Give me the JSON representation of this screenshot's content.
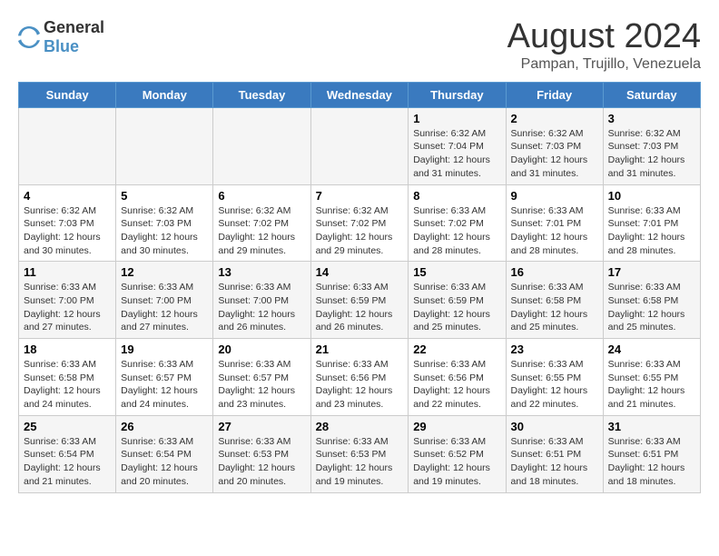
{
  "header": {
    "logo_general": "General",
    "logo_blue": "Blue",
    "title": "August 2024",
    "subtitle": "Pampan, Trujillo, Venezuela"
  },
  "days_of_week": [
    "Sunday",
    "Monday",
    "Tuesday",
    "Wednesday",
    "Thursday",
    "Friday",
    "Saturday"
  ],
  "weeks": [
    [
      {
        "day": "",
        "info": ""
      },
      {
        "day": "",
        "info": ""
      },
      {
        "day": "",
        "info": ""
      },
      {
        "day": "",
        "info": ""
      },
      {
        "day": "1",
        "info": "Sunrise: 6:32 AM\nSunset: 7:04 PM\nDaylight: 12 hours\nand 31 minutes."
      },
      {
        "day": "2",
        "info": "Sunrise: 6:32 AM\nSunset: 7:03 PM\nDaylight: 12 hours\nand 31 minutes."
      },
      {
        "day": "3",
        "info": "Sunrise: 6:32 AM\nSunset: 7:03 PM\nDaylight: 12 hours\nand 31 minutes."
      }
    ],
    [
      {
        "day": "4",
        "info": "Sunrise: 6:32 AM\nSunset: 7:03 PM\nDaylight: 12 hours\nand 30 minutes."
      },
      {
        "day": "5",
        "info": "Sunrise: 6:32 AM\nSunset: 7:03 PM\nDaylight: 12 hours\nand 30 minutes."
      },
      {
        "day": "6",
        "info": "Sunrise: 6:32 AM\nSunset: 7:02 PM\nDaylight: 12 hours\nand 29 minutes."
      },
      {
        "day": "7",
        "info": "Sunrise: 6:32 AM\nSunset: 7:02 PM\nDaylight: 12 hours\nand 29 minutes."
      },
      {
        "day": "8",
        "info": "Sunrise: 6:33 AM\nSunset: 7:02 PM\nDaylight: 12 hours\nand 28 minutes."
      },
      {
        "day": "9",
        "info": "Sunrise: 6:33 AM\nSunset: 7:01 PM\nDaylight: 12 hours\nand 28 minutes."
      },
      {
        "day": "10",
        "info": "Sunrise: 6:33 AM\nSunset: 7:01 PM\nDaylight: 12 hours\nand 28 minutes."
      }
    ],
    [
      {
        "day": "11",
        "info": "Sunrise: 6:33 AM\nSunset: 7:00 PM\nDaylight: 12 hours\nand 27 minutes."
      },
      {
        "day": "12",
        "info": "Sunrise: 6:33 AM\nSunset: 7:00 PM\nDaylight: 12 hours\nand 27 minutes."
      },
      {
        "day": "13",
        "info": "Sunrise: 6:33 AM\nSunset: 7:00 PM\nDaylight: 12 hours\nand 26 minutes."
      },
      {
        "day": "14",
        "info": "Sunrise: 6:33 AM\nSunset: 6:59 PM\nDaylight: 12 hours\nand 26 minutes."
      },
      {
        "day": "15",
        "info": "Sunrise: 6:33 AM\nSunset: 6:59 PM\nDaylight: 12 hours\nand 25 minutes."
      },
      {
        "day": "16",
        "info": "Sunrise: 6:33 AM\nSunset: 6:58 PM\nDaylight: 12 hours\nand 25 minutes."
      },
      {
        "day": "17",
        "info": "Sunrise: 6:33 AM\nSunset: 6:58 PM\nDaylight: 12 hours\nand 25 minutes."
      }
    ],
    [
      {
        "day": "18",
        "info": "Sunrise: 6:33 AM\nSunset: 6:58 PM\nDaylight: 12 hours\nand 24 minutes."
      },
      {
        "day": "19",
        "info": "Sunrise: 6:33 AM\nSunset: 6:57 PM\nDaylight: 12 hours\nand 24 minutes."
      },
      {
        "day": "20",
        "info": "Sunrise: 6:33 AM\nSunset: 6:57 PM\nDaylight: 12 hours\nand 23 minutes."
      },
      {
        "day": "21",
        "info": "Sunrise: 6:33 AM\nSunset: 6:56 PM\nDaylight: 12 hours\nand 23 minutes."
      },
      {
        "day": "22",
        "info": "Sunrise: 6:33 AM\nSunset: 6:56 PM\nDaylight: 12 hours\nand 22 minutes."
      },
      {
        "day": "23",
        "info": "Sunrise: 6:33 AM\nSunset: 6:55 PM\nDaylight: 12 hours\nand 22 minutes."
      },
      {
        "day": "24",
        "info": "Sunrise: 6:33 AM\nSunset: 6:55 PM\nDaylight: 12 hours\nand 21 minutes."
      }
    ],
    [
      {
        "day": "25",
        "info": "Sunrise: 6:33 AM\nSunset: 6:54 PM\nDaylight: 12 hours\nand 21 minutes."
      },
      {
        "day": "26",
        "info": "Sunrise: 6:33 AM\nSunset: 6:54 PM\nDaylight: 12 hours\nand 20 minutes."
      },
      {
        "day": "27",
        "info": "Sunrise: 6:33 AM\nSunset: 6:53 PM\nDaylight: 12 hours\nand 20 minutes."
      },
      {
        "day": "28",
        "info": "Sunrise: 6:33 AM\nSunset: 6:53 PM\nDaylight: 12 hours\nand 19 minutes."
      },
      {
        "day": "29",
        "info": "Sunrise: 6:33 AM\nSunset: 6:52 PM\nDaylight: 12 hours\nand 19 minutes."
      },
      {
        "day": "30",
        "info": "Sunrise: 6:33 AM\nSunset: 6:51 PM\nDaylight: 12 hours\nand 18 minutes."
      },
      {
        "day": "31",
        "info": "Sunrise: 6:33 AM\nSunset: 6:51 PM\nDaylight: 12 hours\nand 18 minutes."
      }
    ]
  ]
}
